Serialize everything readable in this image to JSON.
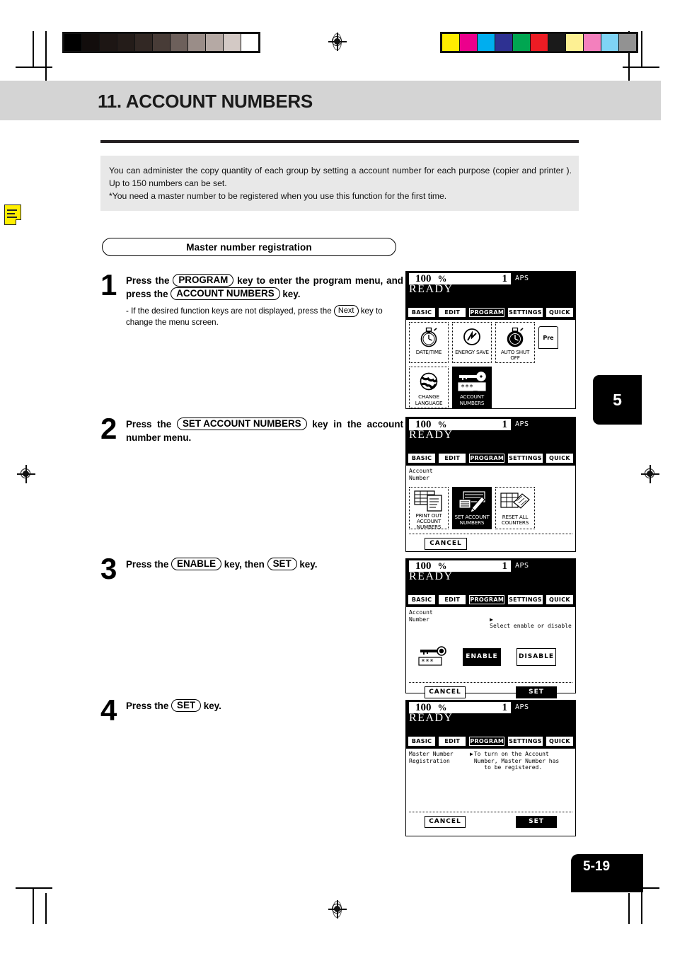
{
  "document": {
    "chapter_tab": "5",
    "page_number": "5-19",
    "title": "11. ACCOUNT NUMBERS",
    "intro_lines": [
      "You can administer the copy quantity of each group by setting a account number for each purpose (copier and printer ). Up to 150 numbers can be set.",
      "*You need a master number to be registered when you use this function for the first time."
    ],
    "section_heading": "Master number registration"
  },
  "colorbars": {
    "grayscale": [
      "#000000",
      "#120d0c",
      "#1d1614",
      "#241c19",
      "#322824",
      "#483c37",
      "#6d605b",
      "#9a8d88",
      "#b5a9a4",
      "#d3c9c5",
      "#ffffff"
    ],
    "process": [
      "#ffed00",
      "#ec008c",
      "#00aeef",
      "#2e3192",
      "#00a651",
      "#ed1c24",
      "#1a1a1a",
      "#fdf093",
      "#f380bd",
      "#7fd4f5",
      "#929292"
    ]
  },
  "steps": [
    {
      "number": "1",
      "lead_parts": [
        {
          "t": "text",
          "v": "Press the  "
        },
        {
          "t": "key",
          "v": "PROGRAM"
        },
        {
          "t": "text",
          "v": " key to enter the program menu, and press the "
        },
        {
          "t": "key",
          "v": "ACCOUNT NUMBERS"
        },
        {
          "t": "text",
          "v": " key."
        }
      ],
      "sub_parts": [
        {
          "t": "text",
          "v": "- If the desired function keys are not displayed, press the "
        },
        {
          "t": "keysmall",
          "v": "Next"
        },
        {
          "t": "text",
          "v": " key to change the menu screen."
        }
      ]
    },
    {
      "number": "2",
      "lead_parts": [
        {
          "t": "text",
          "v": "Press the "
        },
        {
          "t": "key",
          "v": "SET ACCOUNT NUMBERS"
        },
        {
          "t": "text",
          "v": " key in the account number menu."
        }
      ],
      "sub_parts": []
    },
    {
      "number": "3",
      "lead_parts": [
        {
          "t": "text",
          "v": "Press the "
        },
        {
          "t": "key",
          "v": "ENABLE"
        },
        {
          "t": "text",
          "v": " key, then "
        },
        {
          "t": "key",
          "v": "SET"
        },
        {
          "t": "text",
          "v": " key."
        }
      ],
      "sub_parts": []
    },
    {
      "number": "4",
      "lead_parts": [
        {
          "t": "text",
          "v": "Press the "
        },
        {
          "t": "key",
          "v": "SET"
        },
        {
          "t": "text",
          "v": " key."
        }
      ],
      "sub_parts": []
    }
  ],
  "lcd_common": {
    "ratio": "100",
    "percent": "%",
    "copies": "1",
    "paper_mode": "APS",
    "status": "READY",
    "tabs": [
      {
        "label": "BASIC",
        "selected": false
      },
      {
        "label": "EDIT",
        "selected": false
      },
      {
        "label": "PROGRAM",
        "selected": true
      },
      {
        "label": "SETTINGS",
        "selected": false
      },
      {
        "label": "QUICK",
        "selected": false
      }
    ]
  },
  "lcd_panels": [
    {
      "id": "program-menu",
      "icons_row1": [
        {
          "label": "DATE/TIME",
          "icon": "stopwatch-icon",
          "selected": false
        },
        {
          "label": "ENERGY SAVE",
          "icon": "energy-save-icon",
          "selected": false
        },
        {
          "label": "AUTO SHUT OFF",
          "icon": "auto-shut-off-icon",
          "selected": false
        }
      ],
      "next_tag": "Pre",
      "icons_row2": [
        {
          "label": "CHANGE LANGUAGE",
          "icon": "globe-icon",
          "selected": false
        },
        {
          "label": "ACCOUNT NUMBERS",
          "icon": "key-password-icon",
          "selected": true
        }
      ]
    },
    {
      "id": "account-number-menu",
      "caption": "Account\nNumber",
      "icons": [
        {
          "label": "PRINT OUT ACCOUNT NUMBERS",
          "icon": "printout-icon",
          "selected": false
        },
        {
          "label": "SET ACCOUNT NUMBERS",
          "icon": "set-account-icon",
          "selected": true
        },
        {
          "label": "RESET ALL COUNTERS",
          "icon": "reset-counters-icon",
          "selected": false
        }
      ],
      "buttons": [
        {
          "label": "CANCEL",
          "dark": false
        }
      ]
    },
    {
      "id": "enable-disable",
      "caption": "Account\nNumber",
      "message": "Select enable or disable",
      "choices": [
        {
          "label": "ENABLE",
          "selected": true
        },
        {
          "label": "DISABLE",
          "selected": false
        }
      ],
      "buttons": [
        {
          "label": "CANCEL",
          "dark": false
        },
        {
          "label": "SET",
          "dark": true
        }
      ]
    },
    {
      "id": "master-number-registration",
      "caption": "Master Number\nRegistration",
      "message": "To turn on the Account\nNumber, Master Number has\n   to be registered.",
      "buttons": [
        {
          "label": "CANCEL",
          "dark": false
        },
        {
          "label": "SET",
          "dark": true
        }
      ]
    }
  ]
}
